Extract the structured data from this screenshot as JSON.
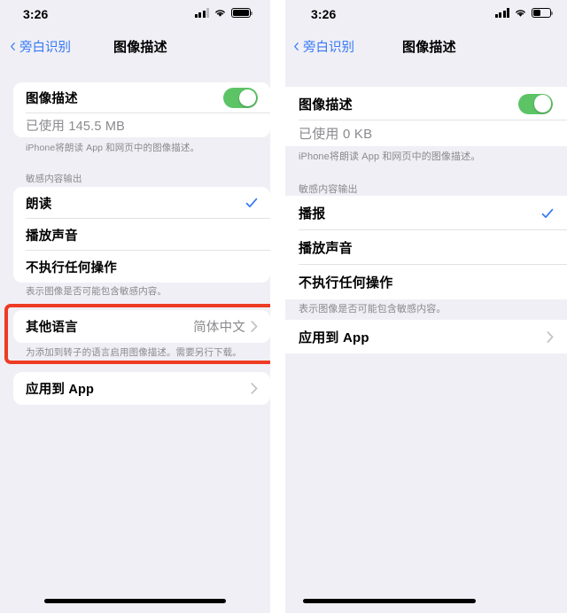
{
  "panels": [
    {
      "id": "left",
      "status": {
        "time": "3:26",
        "battery_level": 100,
        "signal_bars": 3,
        "wifi": "wifi-icon"
      },
      "nav": {
        "back_label": "旁白识别",
        "title": "图像描述"
      },
      "image_desc": {
        "toggle_label": "图像描述",
        "toggle_on": true,
        "usage_label": "已使用 145.5 MB",
        "footnote": "iPhone将朗读 App 和网页中的图像描述。"
      },
      "sensitive": {
        "header": "敏感内容输出",
        "options": [
          {
            "label": "朗读",
            "checked": true
          },
          {
            "label": "播放声音",
            "checked": false
          },
          {
            "label": "不执行任何操作",
            "checked": false
          }
        ],
        "footnote": "表示图像是否可能包含敏感内容。"
      },
      "other_languages": {
        "label": "其他语言",
        "value": "简体中文",
        "footnote": "为添加到转子的语言启用图像描述。需要另行下载。",
        "highlighted": true
      },
      "apply_to_apps": {
        "label": "应用到 App"
      }
    },
    {
      "id": "right",
      "status": {
        "time": "3:26",
        "battery_level": 40,
        "signal_bars": 4,
        "wifi": "wifi-icon"
      },
      "nav": {
        "back_label": "旁白识别",
        "title": "图像描述"
      },
      "image_desc": {
        "toggle_label": "图像描述",
        "toggle_on": true,
        "usage_label": "已使用 0 KB",
        "footnote": "iPhone将朗读 App 和网页中的图像描述。"
      },
      "sensitive": {
        "header": "敏感内容输出",
        "options": [
          {
            "label": "播报",
            "checked": true
          },
          {
            "label": "播放声音",
            "checked": false
          },
          {
            "label": "不执行任何操作",
            "checked": false
          }
        ],
        "footnote": "表示图像是否可能包含敏感内容。"
      },
      "apply_to_apps": {
        "label": "应用到 App"
      }
    }
  ],
  "colors": {
    "accent_blue": "#3478F6",
    "toggle_green": "#5DC466",
    "annotation_red": "#EE3B24",
    "background": "#F0EFF5",
    "card": "#FFFFFF",
    "secondary_text": "#8A8A8E"
  }
}
